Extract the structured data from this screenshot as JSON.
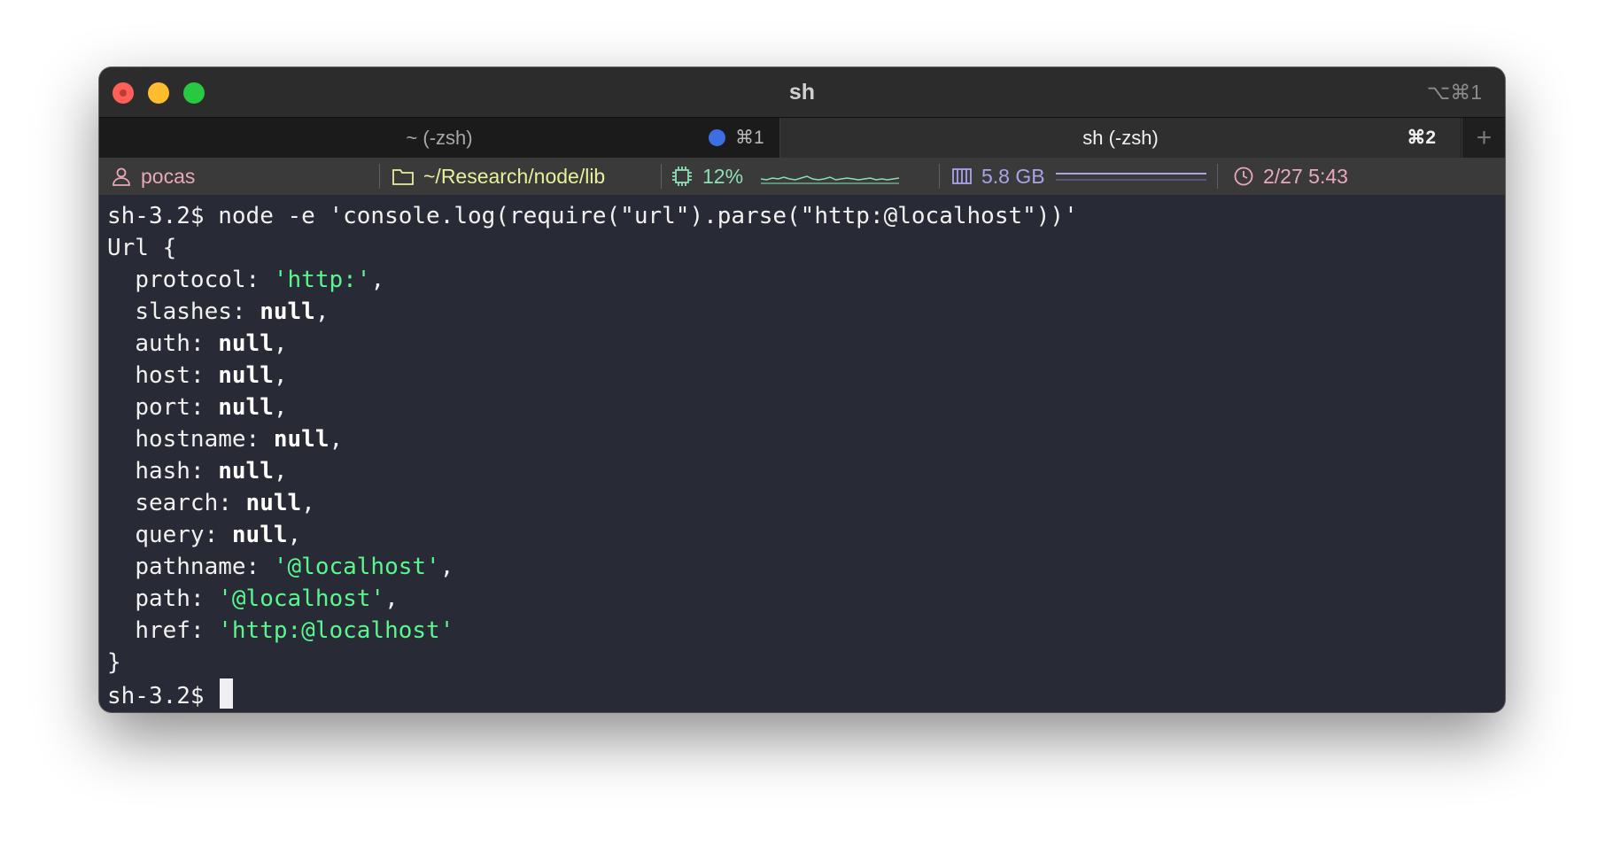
{
  "window": {
    "title": "sh",
    "shortcut": "⌥⌘1"
  },
  "tabs": [
    {
      "label": "~ (-zsh)",
      "shortcut": "⌘1",
      "active": false,
      "indicator_color": "#3e6ee3"
    },
    {
      "label": "sh (-zsh)",
      "shortcut": "⌘2",
      "active": true
    }
  ],
  "tab_add_icon": "plus-icon",
  "status": {
    "user": "pocas",
    "path": "~/Research/node/lib",
    "cpu": "12%",
    "cpu_sparkline_values": [
      0.3,
      0.2,
      0.4,
      0.3,
      0.5,
      0.3,
      0.2,
      0.4,
      0.6,
      0.3,
      0.2,
      0.3,
      0.5,
      0.2,
      0.3,
      0.4,
      0.3,
      0.2,
      0.3,
      0.4,
      0.2,
      0.3,
      0.2,
      0.3,
      0.4
    ],
    "memory": "5.8 GB",
    "clock": "2/27 5:43",
    "colors": {
      "user": "#e8a8b8",
      "path": "#e9ef9a",
      "cpu": "#8be0b2",
      "memory": "#a9a3e8",
      "clock": "#e8a8c0"
    }
  },
  "terminal": {
    "prompt": "sh-3.2$ ",
    "command": "node -e 'console.log(require(\"url\").parse(\"http:@localhost\"))'",
    "object_open": "Url {",
    "properties": [
      {
        "key": "protocol",
        "value": "'http:'",
        "kind": "string",
        "last": false
      },
      {
        "key": "slashes",
        "value": "null",
        "kind": "null",
        "last": false
      },
      {
        "key": "auth",
        "value": "null",
        "kind": "null",
        "last": false
      },
      {
        "key": "host",
        "value": "null",
        "kind": "null",
        "last": false
      },
      {
        "key": "port",
        "value": "null",
        "kind": "null",
        "last": false
      },
      {
        "key": "hostname",
        "value": "null",
        "kind": "null",
        "last": false
      },
      {
        "key": "hash",
        "value": "null",
        "kind": "null",
        "last": false
      },
      {
        "key": "search",
        "value": "null",
        "kind": "null",
        "last": false
      },
      {
        "key": "query",
        "value": "null",
        "kind": "null",
        "last": false
      },
      {
        "key": "pathname",
        "value": "'@localhost'",
        "kind": "string",
        "last": false
      },
      {
        "key": "path",
        "value": "'@localhost'",
        "kind": "string",
        "last": false
      },
      {
        "key": "href",
        "value": "'http:@localhost'",
        "kind": "string",
        "last": true
      }
    ],
    "object_close": "}",
    "final_prompt": "sh-3.2$ "
  }
}
